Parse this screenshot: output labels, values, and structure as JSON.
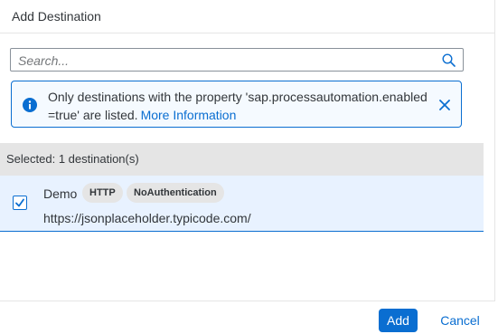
{
  "dialog": {
    "title": "Add Destination"
  },
  "search": {
    "placeholder": "Search...",
    "value": "",
    "icon": "search-icon"
  },
  "info_strip": {
    "icon": "info-icon",
    "message": "Only destinations with the property 'sap.processautomation.enabled =true' are listed.",
    "link_label": "More Information",
    "close_icon": "close-icon"
  },
  "selection": {
    "summary": "Selected: 1 destination(s)"
  },
  "destinations": [
    {
      "name": "Demo",
      "tags": [
        "HTTP",
        "NoAuthentication"
      ],
      "url": "https://jsonplaceholder.typicode.com/",
      "selected": true
    }
  ],
  "footer": {
    "add_label": "Add",
    "cancel_label": "Cancel"
  },
  "colors": {
    "accent": "#0a6ed1",
    "selected_row_bg": "#e8f2ff",
    "info_bg": "#f5faff",
    "tag_bg": "#e5e5e5"
  }
}
